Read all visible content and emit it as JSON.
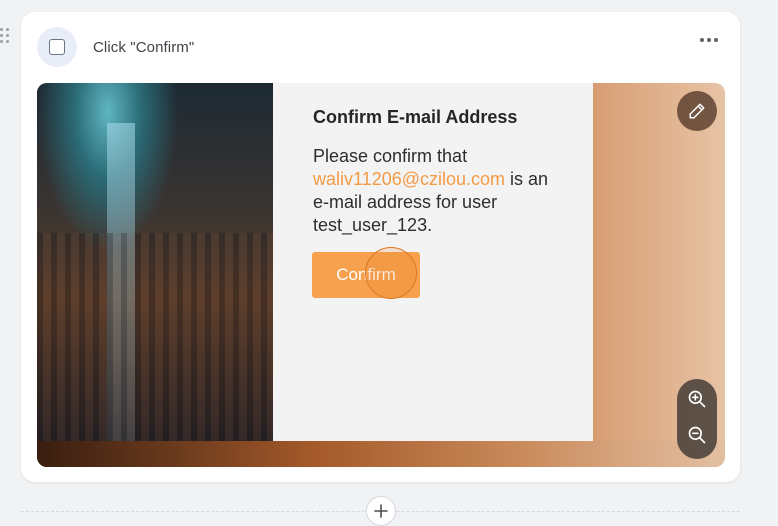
{
  "step": {
    "title": "Click \"Confirm\""
  },
  "dialog": {
    "title": "Confirm E-mail Address",
    "text_before": "Please confirm that ",
    "email": "waliv11206@czilou.com",
    "text_after": " is an e-mail address for user test_user_123.",
    "confirm_label": "Confirm"
  },
  "icons": {
    "drag": "drag-handle-icon",
    "more": "more-horizontal-icon",
    "edit": "pencil-icon",
    "zoom_in": "zoom-in-icon",
    "zoom_out": "zoom-out-icon",
    "add": "plus-icon"
  },
  "colors": {
    "accent": "#f7a14e",
    "email_link": "#f39a45",
    "click_highlight": "#e0761f"
  }
}
